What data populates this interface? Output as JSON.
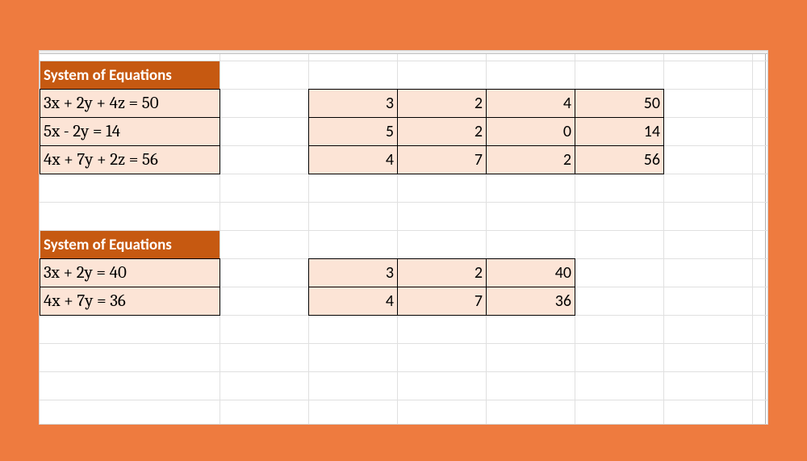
{
  "section1": {
    "header": "System of Equations",
    "equations": {
      "eq1": "3x + 2y + 4z = 50",
      "eq2": "5x - 2y = 14",
      "eq3": "4x + 7y + 2z = 56"
    },
    "matrix": {
      "r1c1": "3",
      "r1c2": "2",
      "r1c3": "4",
      "r1c4": "50",
      "r2c1": "5",
      "r2c2": "2",
      "r2c3": "0",
      "r2c4": "14",
      "r3c1": "4",
      "r3c2": "7",
      "r3c3": "2",
      "r3c4": "56"
    }
  },
  "section2": {
    "header": "System of Equations",
    "equations": {
      "eq1": "3x + 2y = 40",
      "eq2": "4x + 7y = 36"
    },
    "matrix": {
      "r1c1": "3",
      "r1c2": "2",
      "r1c3": "40",
      "r2c1": "4",
      "r2c2": "7",
      "r2c3": "36"
    }
  }
}
